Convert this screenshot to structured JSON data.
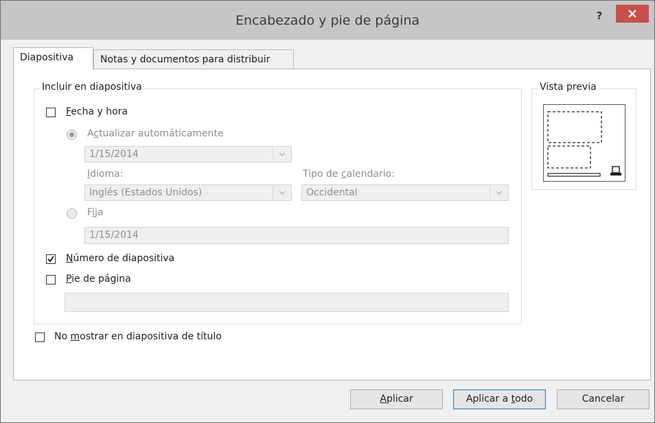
{
  "window": {
    "title": "Encabezado y pie de página",
    "help": "?"
  },
  "tabs": [
    {
      "label": "Diapositiva",
      "active": true
    },
    {
      "label": "Notas y documentos para distribuir",
      "active": false
    }
  ],
  "include_group": {
    "label": "Incluir en diapositiva",
    "date_time": {
      "label_pre": "",
      "label_ul": "F",
      "label_post": "echa y hora",
      "checked": false,
      "auto_update": {
        "pre": "A",
        "ul": "c",
        "post": "tualizar automáticamente",
        "selected": true
      },
      "auto_value": "1/15/2014",
      "language_label": {
        "ul": "I",
        "post": "dioma:"
      },
      "language_value": "Inglés (Estados Unidos)",
      "calendar_label": {
        "pre": "Tipo de ",
        "ul": "c",
        "post": "alendario:"
      },
      "calendar_value": "Occidental",
      "fixed": {
        "pre": "F",
        "ul": "i",
        "post": "ja",
        "selected": false
      },
      "fixed_value": "1/15/2014"
    },
    "slide_number": {
      "ul": "N",
      "post": "úmero de diapositiva",
      "checked": true
    },
    "footer": {
      "ul": "P",
      "post": "ie de página",
      "checked": false,
      "value": ""
    }
  },
  "preview": {
    "label": "Vista previa"
  },
  "no_title": {
    "pre": "No ",
    "ul": "m",
    "post": "ostrar en diapositiva de título",
    "checked": false
  },
  "buttons": {
    "apply": {
      "ul": "A",
      "post": "plicar"
    },
    "apply_all": {
      "pre": "Aplicar a ",
      "ul": "t",
      "post": "odo"
    },
    "cancel": "Cancelar"
  },
  "colors": {
    "titlebar": "#c6c6c6",
    "close": "#c7504a",
    "default_border": "#3c7fb1"
  }
}
